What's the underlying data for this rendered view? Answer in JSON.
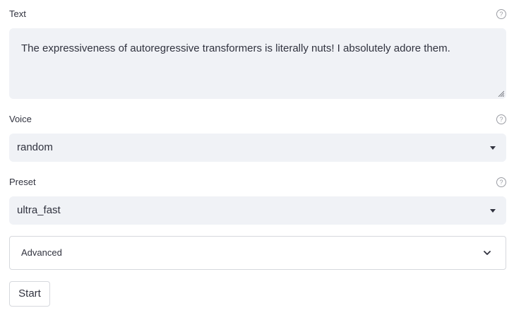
{
  "text_field": {
    "label": "Text",
    "value": "The expressiveness of autoregressive transformers is literally nuts! I absolutely adore them.",
    "help_icon": "question-circle-icon"
  },
  "voice_field": {
    "label": "Voice",
    "selected": "random",
    "help_icon": "question-circle-icon"
  },
  "preset_field": {
    "label": "Preset",
    "selected": "ultra_fast",
    "help_icon": "question-circle-icon"
  },
  "advanced": {
    "label": "Advanced",
    "expanded": false,
    "icon": "chevron-down-icon"
  },
  "start_button": {
    "label": "Start"
  },
  "help_glyph": "?"
}
